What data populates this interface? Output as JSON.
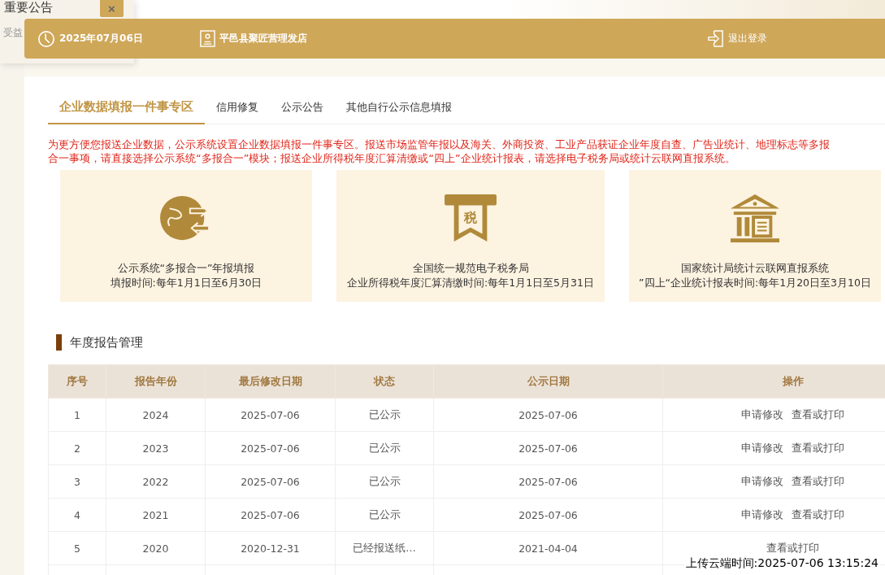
{
  "notice": {
    "title": "重要公告",
    "close": "×",
    "text": "受益"
  },
  "top_bar": {
    "date": "2025年07月06日",
    "shop": "平邑县聚匠营理发店",
    "logout": "退出登录"
  },
  "tabs": [
    {
      "label": "企业数据填报一件事专区",
      "selected": true
    },
    {
      "label": "信用修复",
      "selected": false
    },
    {
      "label": "公示公告",
      "selected": false
    },
    {
      "label": "其他自行公示信息填报",
      "selected": false
    }
  ],
  "notice_lines": [
    "为更方便您报送企业数据，公示系统设置企业数据填报一件事专区。报送市场监管年报以及海关、外商投资、工业产品获证企业年度自查、广告业统计、地理标志等多报",
    "合一事项，请直接选择公示系统“多报合一”模块；报送企业所得税年度汇算清缴或“四上”企业统计报表，请选择电子税务局或统计云联网直报系统。"
  ],
  "cards": [
    {
      "kind": "globe",
      "title": "公示系统“多报合一”年报填报",
      "subtitle": "填报时间:每年1月1日至6月30日"
    },
    {
      "kind": "tax",
      "icon_text": "税",
      "title": "全国统一规范电子税务局",
      "subtitle": "企业所得税年度汇算清缴时间:每年1月1日至5月31日"
    },
    {
      "kind": "bank",
      "title": "国家统计局统计云联网直报系统",
      "subtitle": "”四上“企业统计报表时间:每年1月20日至3月10日"
    }
  ],
  "section_title": "年度报告管理",
  "table": {
    "columns": [
      "序号",
      "报告年份",
      "最后修改日期",
      "状态",
      "公示日期",
      "操作"
    ],
    "rows": [
      {
        "cells": [
          "1",
          "2024",
          "2025-07-06",
          "已公示",
          "2025-07-06"
        ],
        "actions": [
          "申请修改",
          "查看或打印"
        ]
      },
      {
        "cells": [
          "2",
          "2023",
          "2025-07-06",
          "已公示",
          "2025-07-06"
        ],
        "actions": [
          "申请修改",
          "查看或打印"
        ]
      },
      {
        "cells": [
          "3",
          "2022",
          "2025-07-06",
          "已公示",
          "2025-07-06"
        ],
        "actions": [
          "申请修改",
          "查看或打印"
        ]
      },
      {
        "cells": [
          "4",
          "2021",
          "2025-07-06",
          "已公示",
          "2025-07-06"
        ],
        "actions": [
          "申请修改",
          "查看或打印"
        ]
      },
      {
        "cells": [
          "5",
          "2020",
          "2020-12-31",
          "已经报送纸…",
          "2021-04-04"
        ],
        "actions": [
          "查看或打印"
        ]
      }
    ]
  },
  "upload_time": "上传云端时间:2025-07-06 13:15:24"
}
